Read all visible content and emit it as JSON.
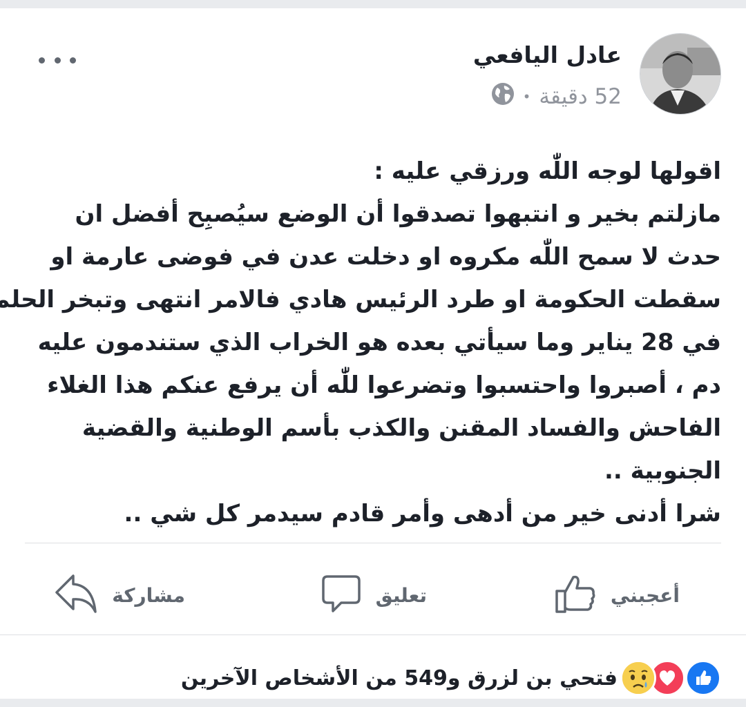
{
  "post": {
    "author": "عادل اليافعي",
    "time": "52 دقيقة",
    "separator": "•",
    "privacy_icon": "globe-icon",
    "lines": [
      "اقولها لوجه اللّٰه ورزقي عليه :",
      "مازلتم بخير و انتبهوا تصدقوا أن الوضع سيُصبِح أفضل ان",
      "حدث لا سمح اللّٰه مكروه او دخلت عدن في فوضى عارمة او",
      "سقطت الحكومة او طرد الرئيس هادي فالامر انتهى وتبخر الحلم",
      "في 28 يناير وما سيأتي بعده هو الخراب الذي ستندمون عليه",
      "دم ،  أصبروا واحتسبوا وتضرعوا  للّٰه أن يرفع عنكم هذا الغلاء",
      "الفاحش والفساد المقنن والكذب بأسم الوطنية والقضية",
      "الجنوبية ..",
      "شرا أدنى خير من أدهى وأمر قادم سيدمر كل شي .."
    ]
  },
  "actions": {
    "like_label": "أعجبني",
    "comment_label": "تعليق",
    "share_label": "مشاركة"
  },
  "reactions": {
    "summary": "فتحي بن لزرق و549 من الأشخاص الآخرين",
    "icons": [
      "like-reaction-icon",
      "love-reaction-icon",
      "sad-reaction-icon"
    ],
    "colors": {
      "like": "#1877f2",
      "love": "#f33e58",
      "sad": "#f7b125"
    }
  },
  "colors": {
    "accent": "#1d2129",
    "muted": "#90949c",
    "action": "#606770"
  }
}
